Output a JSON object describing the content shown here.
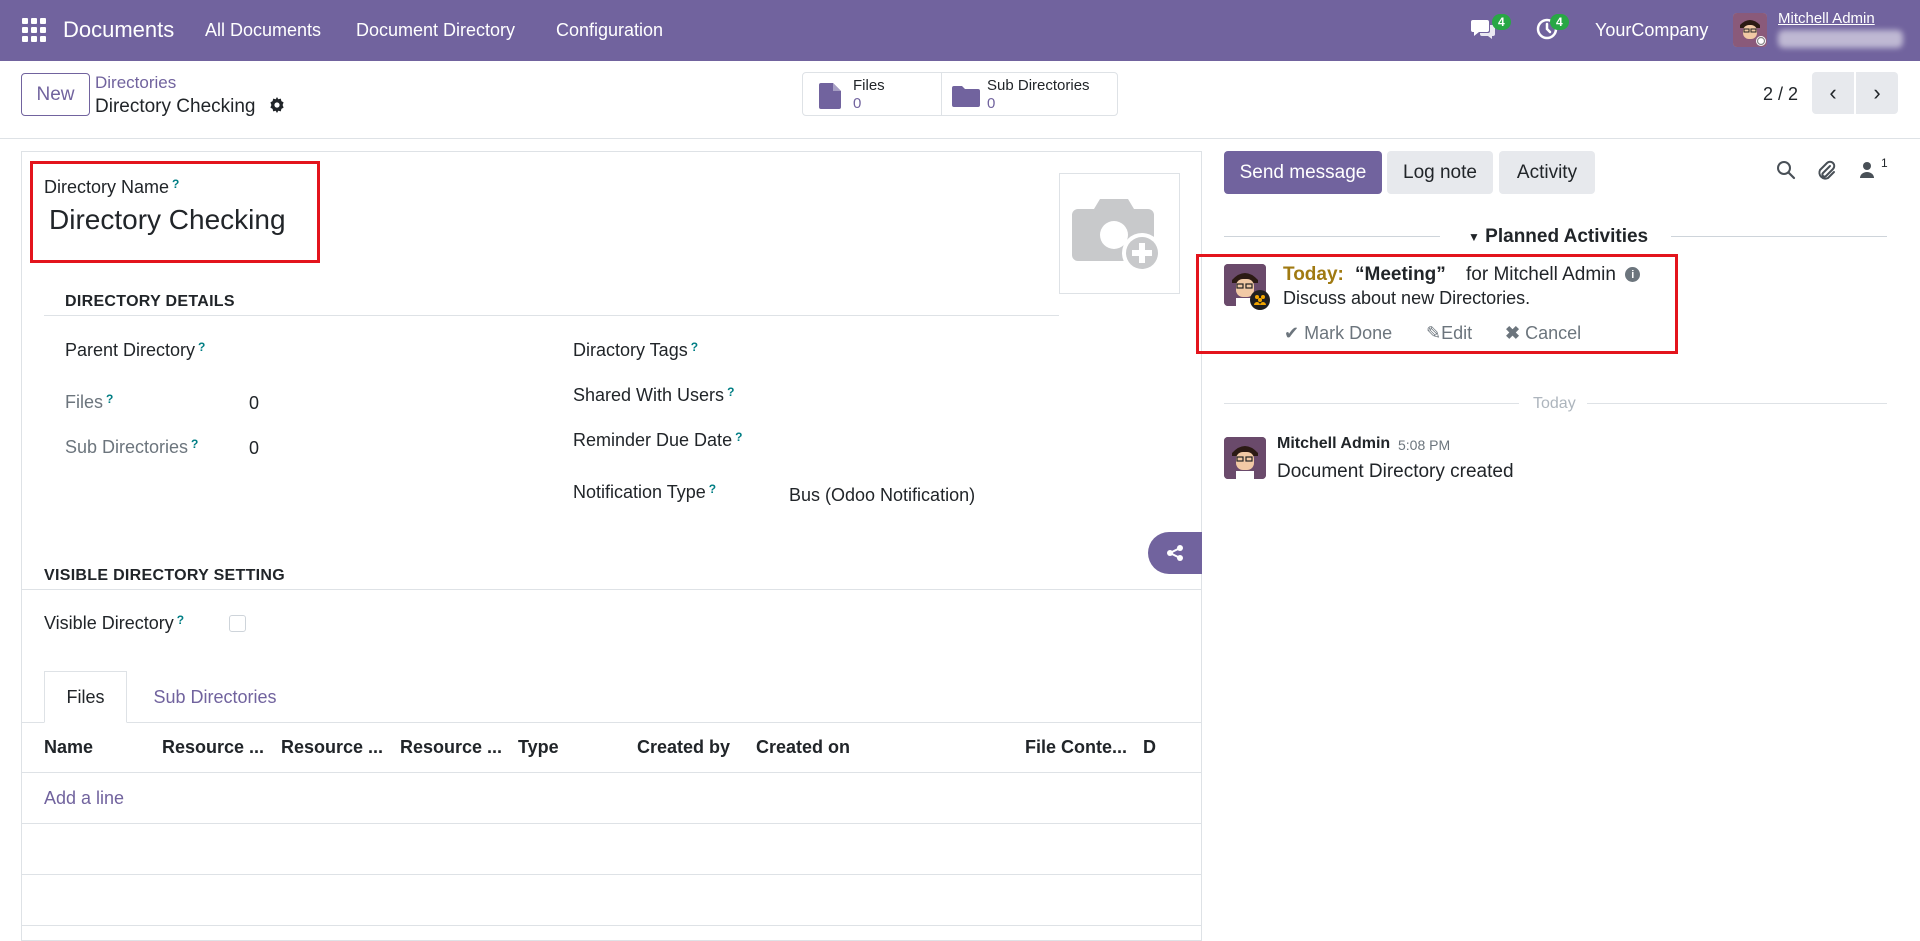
{
  "navbar": {
    "brand": "Documents",
    "menu": [
      "All Documents",
      "Document Directory",
      "Configuration"
    ],
    "messages_badge": "4",
    "activities_badge": "4",
    "company": "YourCompany",
    "user_name": "Mitchell Admin"
  },
  "control": {
    "new_label": "New",
    "breadcrumb_parent": "Directories",
    "breadcrumb_current": "Directory Checking",
    "smart_files_label": "Files",
    "smart_files_value": "0",
    "smart_subdirs_label": "Sub Directories",
    "smart_subdirs_value": "0",
    "pager": "2 / 2"
  },
  "form": {
    "name_label": "Directory Name",
    "name_value": "Directory Checking",
    "help_mark": "?",
    "section_details": "DIRECTORY DETAILS",
    "parent_label": "Parent Directory",
    "files_label": "Files",
    "files_value": "0",
    "subdirs_label": "Sub Directories",
    "subdirs_value": "0",
    "tags_label": "Diractory Tags",
    "shared_label": "Shared With Users",
    "reminder_label": "Reminder Due Date",
    "notif_label": "Notification Type",
    "notif_value": "Bus (Odoo Notification)",
    "section_visible": "VISIBLE DIRECTORY SETTING",
    "visible_label": "Visible Directory",
    "visible_checked": false
  },
  "notebook": {
    "tabs": [
      "Files",
      "Sub Directories"
    ],
    "columns": [
      "Name",
      "Resource ...",
      "Resource ...",
      "Resource ...",
      "Type",
      "Created by",
      "Created on",
      "File Conte...",
      "D"
    ],
    "add_line": "Add a line"
  },
  "chatter": {
    "send_message": "Send message",
    "log_note": "Log note",
    "activity": "Activity",
    "followers_count": "1",
    "planned_title": "Planned Activities",
    "activity_today": "Today:",
    "activity_summary": "“Meeting”",
    "activity_for": "for Mitchell Admin",
    "activity_note": "Discuss about new Directories.",
    "mark_done": "Mark Done",
    "edit": "Edit",
    "cancel": "Cancel",
    "today_sep": "Today",
    "msg_author": "Mitchell Admin",
    "msg_time": "5:08 PM",
    "msg_body": "Document Directory created"
  },
  "colors": {
    "brand": "#71639e",
    "highlight_box": "#e3141c",
    "badge": "#28a745",
    "today": "#a07a12"
  }
}
